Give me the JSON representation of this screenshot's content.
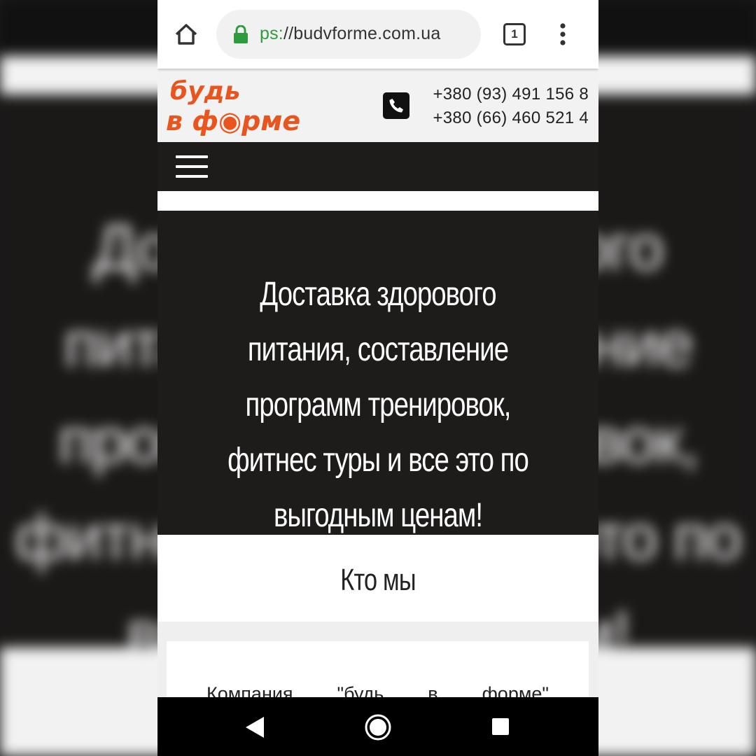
{
  "browser": {
    "url_scheme": "ps:",
    "url_host": "//budvforme.com.ua",
    "tab_count": "1"
  },
  "site": {
    "logo_line1": "будь",
    "logo_line2": "в ф◉рме",
    "phone1": "+380 (93) 491 156 8",
    "phone2": "+380 (66) 460 521 4"
  },
  "hero": {
    "text": "Доставка здорового питания, составление программ тренировок, фитнес туры и все это по выгодным ценам!"
  },
  "about": {
    "title": "Кто мы",
    "snippet": "Компания \"будь в форме\""
  },
  "colors": {
    "brand_orange": "#e8551f",
    "dark_bg": "#1e1c1b",
    "secure_green": "#2e9b3e"
  }
}
